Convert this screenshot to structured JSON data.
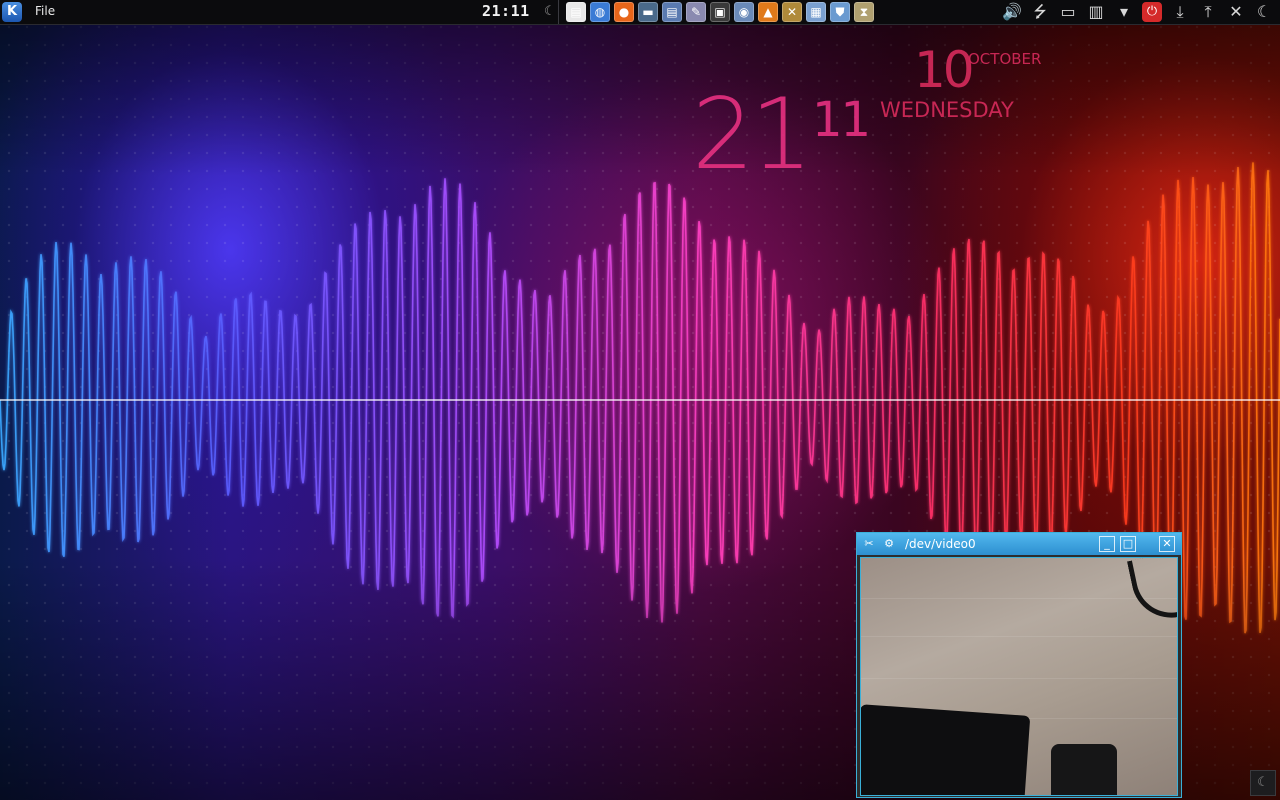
{
  "panel": {
    "menu_file": "File",
    "clock": "21:11",
    "launchers": [
      {
        "icon": "files-icon",
        "glyph": "▤",
        "color": "#e8e8e8"
      },
      {
        "icon": "network-icon",
        "glyph": "◍",
        "color": "#3a7bd5"
      },
      {
        "icon": "firefox-icon",
        "glyph": "●",
        "color": "#e8661a"
      },
      {
        "icon": "chat-icon",
        "glyph": "▬",
        "color": "#4a6a8a"
      },
      {
        "icon": "document-icon",
        "glyph": "▤",
        "color": "#5a7ab0"
      },
      {
        "icon": "notes-icon",
        "glyph": "✎",
        "color": "#8a8ab0"
      },
      {
        "icon": "monitor-icon",
        "glyph": "▣",
        "color": "#3a3a3a"
      },
      {
        "icon": "disk-icon",
        "glyph": "◉",
        "color": "#6a8ab8"
      },
      {
        "icon": "vlc-icon",
        "glyph": "▲",
        "color": "#e07a1a"
      },
      {
        "icon": "tools-icon",
        "glyph": "✕",
        "color": "#b08a3a"
      },
      {
        "icon": "calendar-icon",
        "glyph": "▦",
        "color": "#7aa0d0"
      },
      {
        "icon": "shield-icon",
        "glyph": "⛊",
        "color": "#6a9ad0"
      },
      {
        "icon": "hourglass-icon",
        "glyph": "⧗",
        "color": "#b0a070"
      }
    ],
    "tray": [
      {
        "icon": "volume-icon",
        "glyph": "🔊"
      },
      {
        "icon": "usb-icon",
        "glyph": "⭍"
      },
      {
        "icon": "display-icon",
        "glyph": "▭"
      },
      {
        "icon": "battery-icon",
        "glyph": "▥"
      },
      {
        "icon": "arrow-down-icon",
        "glyph": "▾"
      },
      {
        "icon": "power-icon",
        "glyph": "⏻"
      },
      {
        "icon": "download-icon",
        "glyph": "⤓"
      },
      {
        "icon": "upload-icon",
        "glyph": "⤒"
      },
      {
        "icon": "close-icon",
        "glyph": "✕"
      },
      {
        "icon": "moon-icon",
        "glyph": "☾"
      }
    ]
  },
  "desktop_clock": {
    "hour": "21",
    "minute": "11",
    "day": "10",
    "month": "OCTOBER",
    "weekday": "WEDNESDAY"
  },
  "webcam_window": {
    "title": "/dev/video0",
    "minimize": "_",
    "maximize": "□",
    "close": "✕"
  },
  "colors": {
    "accent_pink": "#e3307f",
    "titlebar_blue": "#2d8fd0"
  }
}
